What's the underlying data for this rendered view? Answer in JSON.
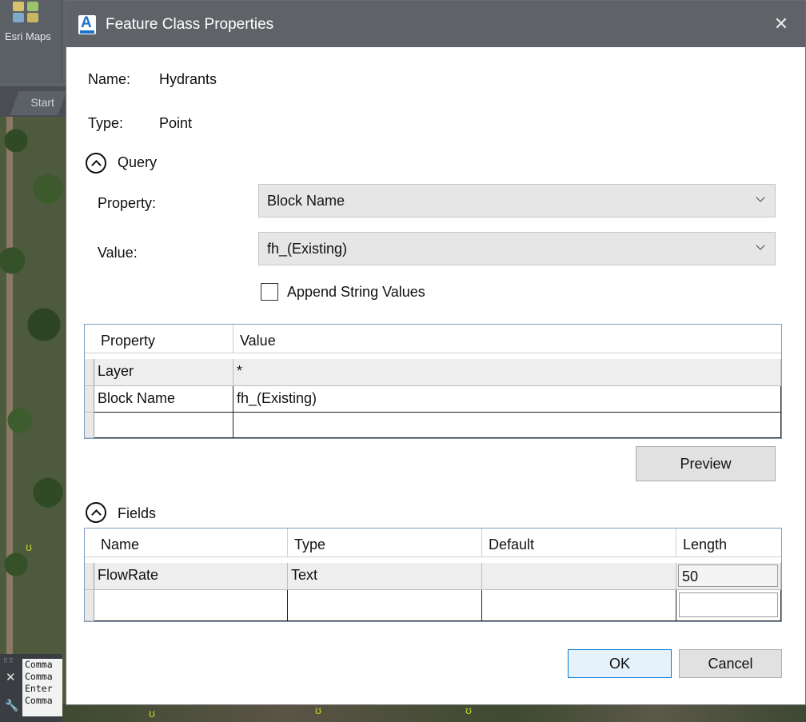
{
  "background": {
    "esri_button_label": "Esri Maps",
    "start_tab_label": "Start",
    "command_lines": [
      "Comma",
      "Comma",
      "Enter",
      "Comma"
    ]
  },
  "dialog": {
    "title": "Feature Class Properties",
    "name_label": "Name:",
    "name_value": "Hydrants",
    "type_label": "Type:",
    "type_value": "Point",
    "query": {
      "section_label": "Query",
      "property_label": "Property:",
      "property_value": "Block Name",
      "value_label": "Value:",
      "value_value": "fh_(Existing)",
      "append_label": "Append String Values",
      "append_checked": false,
      "table": {
        "headers": [
          "Property",
          "Value"
        ],
        "rows": [
          [
            "Layer",
            "*"
          ],
          [
            "Block Name",
            "fh_(Existing)"
          ],
          [
            "",
            ""
          ]
        ]
      },
      "preview_label": "Preview"
    },
    "fields": {
      "section_label": "Fields",
      "table": {
        "headers": [
          "Name",
          "Type",
          "Default",
          "Length"
        ],
        "rows": [
          [
            "FlowRate",
            "Text",
            "",
            "50"
          ],
          [
            "",
            "",
            "",
            ""
          ]
        ]
      }
    },
    "ok_label": "OK",
    "cancel_label": "Cancel"
  },
  "colors": {
    "titlebar": "#5f6368",
    "accent": "#0a7ad6",
    "app_icon": "#1f73c7"
  }
}
